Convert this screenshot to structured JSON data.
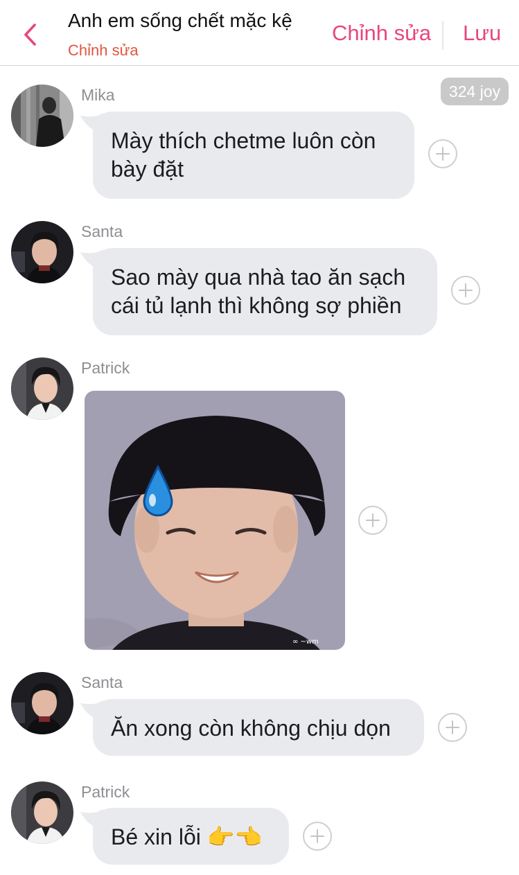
{
  "header": {
    "title": "Anh em sống chết mặc kệ",
    "subtitle": "Chỉnh sửa",
    "edit_label": "Chỉnh sửa",
    "save_label": "Lưu"
  },
  "badge": "324 joy",
  "messages": [
    {
      "name": "Mika",
      "text": "Mày thích chetme luôn còn bày đặt"
    },
    {
      "name": "Santa",
      "text": "Sao mày qua nhà tao ăn sạch cái tủ lạnh thì không sợ phiền"
    },
    {
      "name": "Patrick",
      "image": "reaction-photo"
    },
    {
      "name": "Santa",
      "text": "Ăn xong còn không chịu dọn"
    },
    {
      "name": "Patrick",
      "text": "Bé xin lỗi 👉👈"
    }
  ],
  "colors": {
    "accent": "#e8477c",
    "subtitle": "#e2553f",
    "bubble": "#e9eaed",
    "badge": "#c9c9c9"
  }
}
